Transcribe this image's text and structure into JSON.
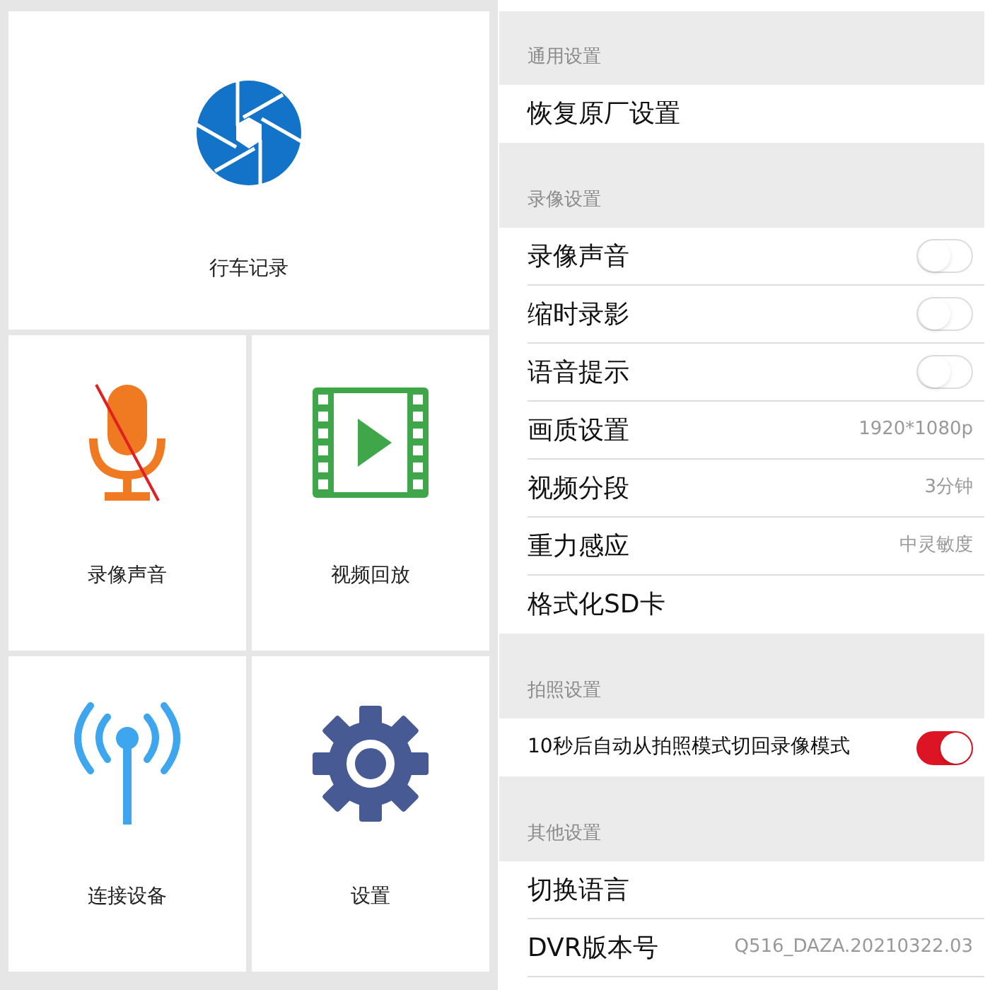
{
  "home": {
    "tiles": [
      {
        "label": "行车记录",
        "kind": "aperture"
      },
      {
        "label": "录像声音",
        "kind": "mic_off"
      },
      {
        "label": "视频回放",
        "kind": "film"
      },
      {
        "label": "连接设备",
        "kind": "antenna"
      },
      {
        "label": "设置",
        "kind": "gear"
      }
    ]
  },
  "settings": {
    "sections": [
      {
        "title": "通用设置",
        "rows": [
          {
            "kind": "link",
            "label": "恢复原厂设置"
          }
        ]
      },
      {
        "title": "录像设置",
        "rows": [
          {
            "kind": "toggle",
            "label": "录像声音",
            "on": false
          },
          {
            "kind": "toggle",
            "label": "缩时录影",
            "on": false
          },
          {
            "kind": "toggle",
            "label": "语音提示",
            "on": false
          },
          {
            "kind": "value",
            "label": "画质设置",
            "value": "1920*1080p"
          },
          {
            "kind": "value",
            "label": "视频分段",
            "value": "3分钟"
          },
          {
            "kind": "value",
            "label": "重力感应",
            "value": "中灵敏度"
          },
          {
            "kind": "link",
            "label": "格式化SD卡"
          }
        ]
      },
      {
        "title": "拍照设置",
        "rows": [
          {
            "kind": "toggle",
            "label": "10秒后自动从拍照模式切回录像模式",
            "on": true
          }
        ]
      },
      {
        "title": "其他设置",
        "rows": [
          {
            "kind": "link",
            "label": "切换语言"
          },
          {
            "kind": "value",
            "label": "DVR版本号",
            "value": "Q516_DAZA.20210322.03"
          }
        ]
      }
    ]
  }
}
